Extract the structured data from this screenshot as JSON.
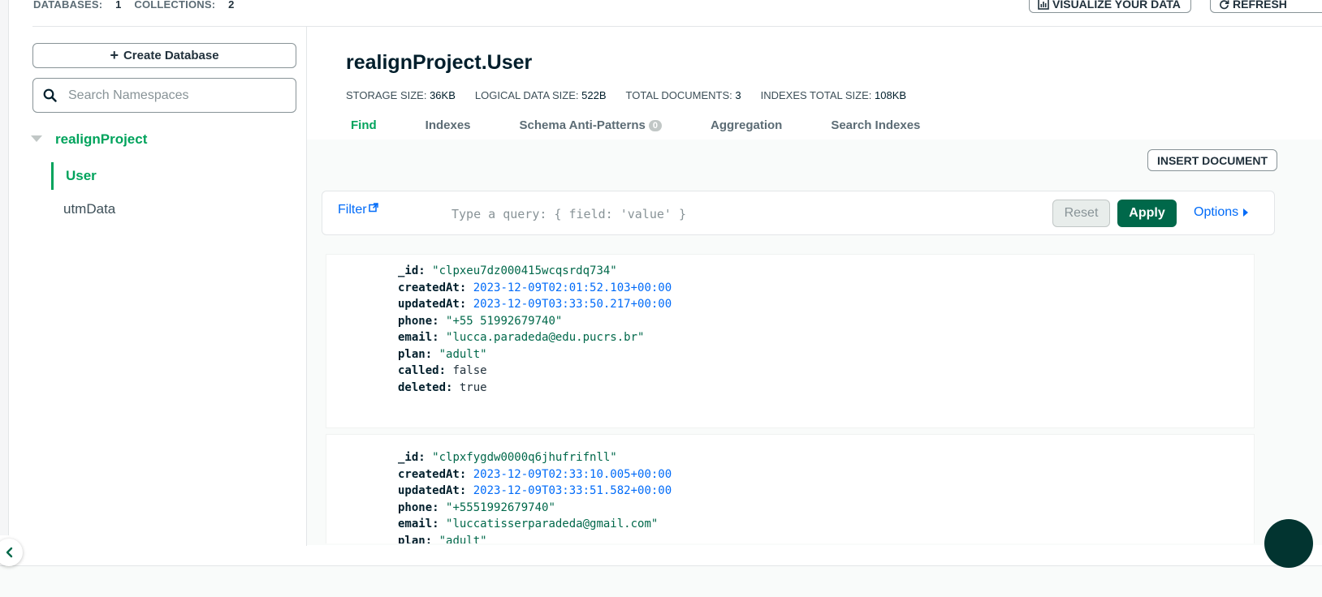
{
  "header": {
    "databases_label": "DATABASES:",
    "databases_count": "1",
    "collections_label": "COLLECTIONS:",
    "collections_count": "2",
    "visualize_label": "VISUALIZE YOUR DATA",
    "refresh_label": "REFRESH"
  },
  "sidebar": {
    "create_db_label": "Create Database",
    "search_placeholder": "Search Namespaces",
    "database_name": "realignProject",
    "collections": [
      "User",
      "utmData"
    ]
  },
  "main": {
    "title": "realignProject.User",
    "stats": [
      {
        "label": "STORAGE SIZE:",
        "value": "36KB"
      },
      {
        "label": "LOGICAL DATA SIZE:",
        "value": "522B"
      },
      {
        "label": "TOTAL DOCUMENTS:",
        "value": "3"
      },
      {
        "label": "INDEXES TOTAL SIZE:",
        "value": "108KB"
      }
    ],
    "tabs": [
      "Find",
      "Indexes",
      "Schema Anti-Patterns",
      "Aggregation",
      "Search Indexes"
    ],
    "anti_patterns_count": "0",
    "insert_label": "INSERT DOCUMENT",
    "filter_label": "Filter",
    "query_placeholder": "Type a query: { field: 'value' }",
    "reset_label": "Reset",
    "apply_label": "Apply",
    "options_label": "Options"
  },
  "documents": [
    {
      "_id": "\"clpxeu7dz000415wcqsrdq734\"",
      "createdAt": "2023-12-09T02:01:52.103+00:00",
      "updatedAt": "2023-12-09T03:33:50.217+00:00",
      "phone": "\"+55 51992679740\"",
      "email": "\"lucca.paradeda@edu.pucrs.br\"",
      "plan": "\"adult\"",
      "called": "false",
      "deleted": "true"
    },
    {
      "_id": "\"clpxfygdw0000q6jhufrifnll\"",
      "createdAt": "2023-12-09T02:33:10.005+00:00",
      "updatedAt": "2023-12-09T03:33:51.582+00:00",
      "phone": "\"+5551992679740\"",
      "email": "\"luccatisserparadeda@gmail.com\"",
      "plan": "\"adult\""
    }
  ],
  "field_labels": {
    "_id": "_id:",
    "createdAt": "createdAt:",
    "updatedAt": "updatedAt:",
    "phone": "phone:",
    "email": "email:",
    "plan": "plan:",
    "called": "called:",
    "deleted": "deleted:"
  }
}
